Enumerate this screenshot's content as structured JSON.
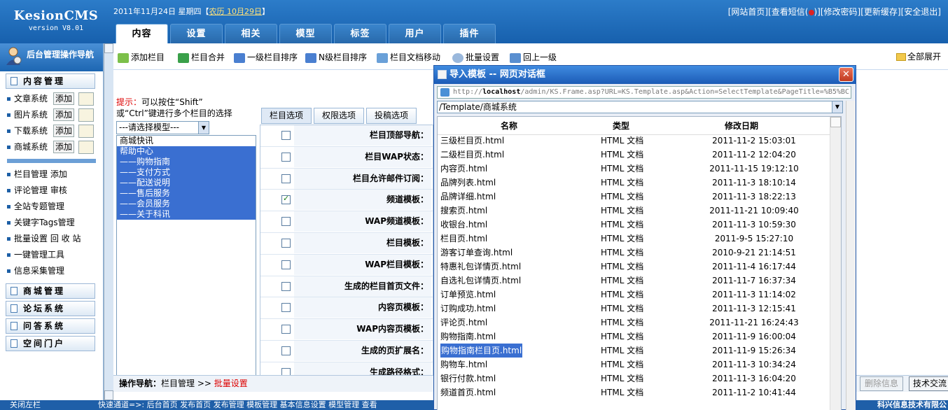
{
  "header": {
    "logo_name": "KesionCMS",
    "logo_version": "version V8.01",
    "date_prefix": "2011年11月24日 星期四【",
    "lunar": "农历 10月29日",
    "date_suffix": "】",
    "links": {
      "site_home": "[网站首页]",
      "view_sms_open": "[查看短信(",
      "view_sms_close": ")]",
      "change_password": "[修改密码]",
      "update_cache": "[更新缓存]",
      "logout": "[安全退出]"
    },
    "tabs": [
      "内容",
      "设置",
      "相关",
      "模型",
      "标签",
      "用户",
      "插件"
    ]
  },
  "leftnav": {
    "title": "后台管理操作导航",
    "content_group": "内容管理",
    "systems": [
      {
        "label": "文章系统",
        "button": "添加"
      },
      {
        "label": "图片系统",
        "button": "添加"
      },
      {
        "label": "下载系统",
        "button": "添加"
      },
      {
        "label": "商城系统",
        "button": "添加"
      }
    ],
    "links": [
      "栏目管理 添加",
      "评论管理 审核",
      "全站专题管理",
      "关键字Tags管理",
      "批量设置 回 收 站",
      "一键管理工具",
      "信息采集管理"
    ],
    "groups": [
      "商城管理",
      "论坛系统",
      "问答系统",
      "空间门户"
    ]
  },
  "toolbar": {
    "items": [
      "添加栏目",
      "栏目合并",
      "一级栏目排序",
      "N级栏目排序",
      "栏目文档移动",
      "批量设置",
      "回上一级"
    ],
    "expand_all": "全部展开"
  },
  "hint": {
    "prefix": "提示：",
    "line1": "可以按住“Shift”",
    "line2": "或“Ctrl”键进行多个栏目的选择"
  },
  "model_select": "---请选择模型---",
  "categories": [
    {
      "label": "商城快讯",
      "selected": false
    },
    {
      "label": "帮助中心",
      "selected": true
    },
    {
      "label": "——购物指南",
      "selected": true
    },
    {
      "label": "——支付方式",
      "selected": true
    },
    {
      "label": "——配送说明",
      "selected": true
    },
    {
      "label": "——售后服务",
      "selected": true
    },
    {
      "label": "——会员服务",
      "selected": true
    },
    {
      "label": "——关于科讯",
      "selected": true
    }
  ],
  "option_tabs": [
    "栏目选项",
    "权限选项",
    "投稿选项"
  ],
  "form_rows": [
    {
      "label": "栏目顶部导航：",
      "checked": false
    },
    {
      "label": "栏目WAP状态：",
      "checked": false
    },
    {
      "label": "栏目允许邮件订阅：",
      "checked": false
    },
    {
      "label": "频道模板：",
      "checked": true
    },
    {
      "label": "WAP频道模板：",
      "checked": false
    },
    {
      "label": "栏目模板：",
      "checked": false
    },
    {
      "label": "WAP栏目模板：",
      "checked": false
    },
    {
      "label": "生成的栏目首页文件：",
      "checked": false
    },
    {
      "label": "内容页模板：",
      "checked": false
    },
    {
      "label": "WAP内容页模板：",
      "checked": false
    },
    {
      "label": "生成的页扩展名：",
      "checked": false
    },
    {
      "label": "生成路径格式：",
      "checked": false
    }
  ],
  "op_nav": {
    "label": "操作导航：",
    "path": "栏目管理 >> ",
    "current": "批量设置"
  },
  "bottom_buttons": {
    "delete": "删除信息",
    "tech": "技术交流"
  },
  "statusbar": {
    "close": "关闭左栏",
    "quick": "快速通道=>:  后台首页  发布首页  发布管理  模板管理  基本信息设置  模型管理  查看",
    "corp": "科兴信息技术有限公"
  },
  "dialog": {
    "title": "导入模板 -- 网页对话框",
    "url_prefix": "http://",
    "url_host": "localhost",
    "url_rest": "/admin/KS.Frame.asp?URL=KS.Template.asp&Action=SelectTemplate&PageTitle=%B5%BC",
    "path": "/Template/商城系统",
    "columns": {
      "name": "名称",
      "type": "类型",
      "date": "修改日期"
    },
    "files": [
      {
        "name": "三级栏目页.html",
        "type": "HTML 文档",
        "date": "2011-11-2 15:03:01"
      },
      {
        "name": "二级栏目页.html",
        "type": "HTML 文档",
        "date": "2011-11-2 12:04:20"
      },
      {
        "name": "内容页.html",
        "type": "HTML 文档",
        "date": "2011-11-15 19:12:10"
      },
      {
        "name": "品牌列表.html",
        "type": "HTML 文档",
        "date": "2011-11-3 18:10:14"
      },
      {
        "name": "品牌详细.html",
        "type": "HTML 文档",
        "date": "2011-11-3 18:22:13"
      },
      {
        "name": "搜索页.html",
        "type": "HTML 文档",
        "date": "2011-11-21 10:09:40"
      },
      {
        "name": "收银台.html",
        "type": "HTML 文档",
        "date": "2011-11-3 10:59:30"
      },
      {
        "name": "栏目页.html",
        "type": "HTML 文档",
        "date": "2011-9-5 15:27:10"
      },
      {
        "name": "游客订单查询.html",
        "type": "HTML 文档",
        "date": "2010-9-21 21:14:51"
      },
      {
        "name": "特惠礼包详情页.html",
        "type": "HTML 文档",
        "date": "2011-11-4 16:17:44"
      },
      {
        "name": "自选礼包详情页.html",
        "type": "HTML 文档",
        "date": "2011-11-7 16:37:34"
      },
      {
        "name": "订单预览.html",
        "type": "HTML 文档",
        "date": "2011-11-3 11:14:02"
      },
      {
        "name": "订购成功.html",
        "type": "HTML 文档",
        "date": "2011-11-3 12:15:41"
      },
      {
        "name": "评论页.html",
        "type": "HTML 文档",
        "date": "2011-11-21 16:24:43"
      },
      {
        "name": "购物指南.html",
        "type": "HTML 文档",
        "date": "2011-11-9 16:00:04"
      },
      {
        "name": "购物指南栏目页.html",
        "type": "HTML 文档",
        "date": "2011-11-9 15:26:34",
        "selected": true
      },
      {
        "name": "购物车.html",
        "type": "HTML 文档",
        "date": "2011-11-3 10:34:24"
      },
      {
        "name": "银行付款.html",
        "type": "HTML 文档",
        "date": "2011-11-3 16:04:20"
      },
      {
        "name": "频道首页.html",
        "type": "HTML 文档",
        "date": "2011-11-2 10:41:44"
      }
    ]
  }
}
